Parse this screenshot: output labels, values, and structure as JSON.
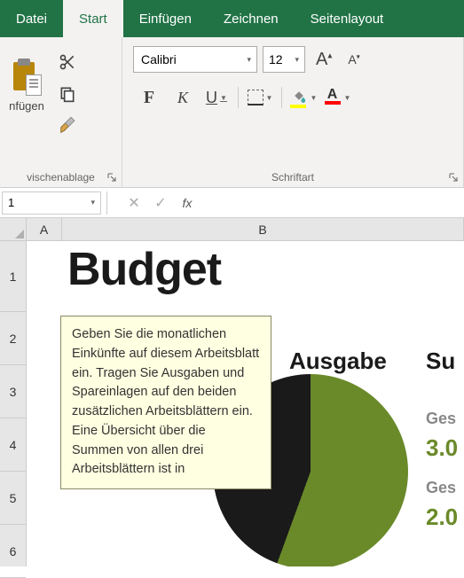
{
  "tabs": {
    "file": "Datei",
    "home": "Start",
    "insert": "Einfügen",
    "draw": "Zeichnen",
    "layout": "Seitenlayout"
  },
  "ribbon": {
    "paste_label": "nfügen",
    "clipboard_group": "vischenablage",
    "font_group": "Schriftart",
    "font_name": "Calibri",
    "font_size": "12",
    "bold": "F",
    "italic": "K",
    "underline": "U"
  },
  "formula_bar": {
    "name_box": "1",
    "fx": "fx"
  },
  "columns": {
    "A": "A",
    "B": "B"
  },
  "rows": [
    "1",
    "2",
    "3",
    "4",
    "5",
    "6"
  ],
  "sheet": {
    "title": "Budget",
    "tooltip": "Geben Sie die monatlichen Einkünfte auf diesem Arbeitsblatt ein. Tragen Sie Ausgaben und Spareinlagen auf den beiden zusätzlichen Arbeitsblättern ein. Eine Übersicht über die Summen von allen drei Arbeitsblättern ist in",
    "col_expense": "Ausgabe",
    "col_sum_partial": "Su",
    "label_total1": "Ges",
    "value1": "3.0",
    "label_total2": "Ges",
    "value2": "2.0"
  },
  "colors": {
    "brand": "#217346",
    "pie_green": "#6a8a2a",
    "pie_dark": "#1a1a1a",
    "value_green": "#6a8a2a"
  }
}
